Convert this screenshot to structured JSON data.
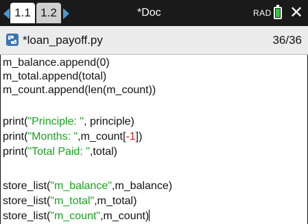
{
  "topbar": {
    "tabs": [
      {
        "label": "1.1"
      },
      {
        "label": "1.2"
      }
    ],
    "doc_title": "*Doc",
    "mode": "RAD",
    "close_symbol": "✕"
  },
  "file": {
    "name": "*loan_payoff.py",
    "line_count": "36/36"
  },
  "editor": {
    "lines": [
      {
        "t1": "m_balance.append(0)"
      },
      {
        "t1": "m_total.append(total)"
      },
      {
        "t1": "m_count.append(len(m_count))"
      },
      {
        "t1": ""
      },
      {
        "t1": "print(",
        "s1": "\"Principle: \"",
        "t2": ", principle)"
      },
      {
        "t1": "print(",
        "s1": "\"Months: \"",
        "t2": ",m_count[",
        "n1": "-1",
        "t3": "])"
      },
      {
        "t1": "print(",
        "s1": "\"Total Paid: \"",
        "t2": ",total)"
      },
      {
        "t1": ""
      },
      {
        "t1": "store_list(",
        "s1": "\"m_balance\"",
        "t2": ",m_balance)"
      },
      {
        "t1": "store_list(",
        "s1": "\"m_total\"",
        "t2": ",m_total)"
      },
      {
        "t1": "store_list(",
        "s1": "\"m_count\"",
        "t2": ",m_count)"
      }
    ]
  },
  "colors": {
    "string": "#16a31c",
    "number": "#e01b24",
    "battery": "#2ecc40",
    "nav_arrow": "#4a9ad4"
  },
  "icons": {
    "python_file": "python-logo-icon",
    "battery": "battery-icon",
    "close": "close-icon"
  }
}
